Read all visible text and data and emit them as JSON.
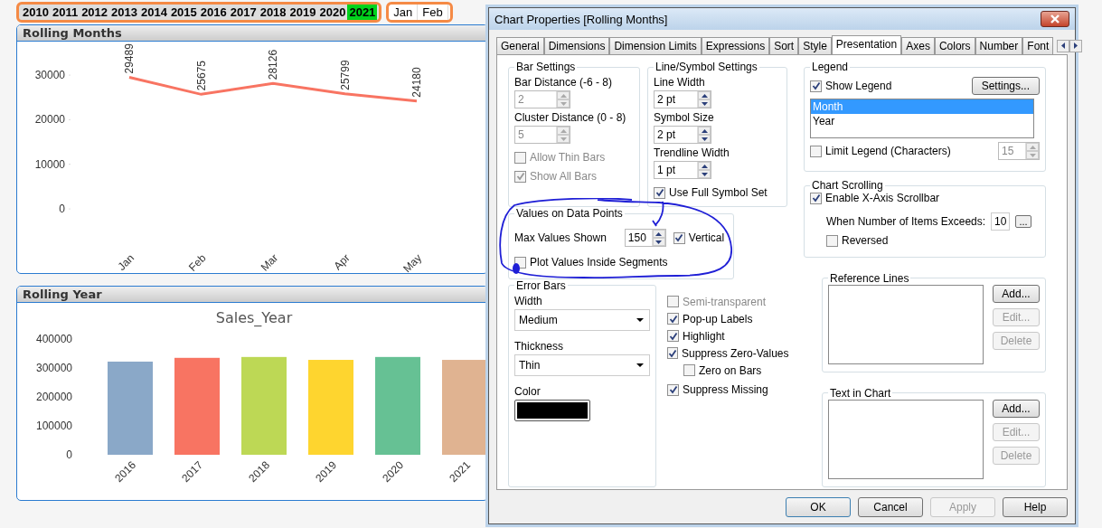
{
  "year_filter": [
    {
      "label": "2010",
      "selected": false
    },
    {
      "label": "2011",
      "selected": false
    },
    {
      "label": "2012",
      "selected": false
    },
    {
      "label": "2013",
      "selected": false
    },
    {
      "label": "2014",
      "selected": false
    },
    {
      "label": "2015",
      "selected": false
    },
    {
      "label": "2016",
      "selected": false
    },
    {
      "label": "2017",
      "selected": false
    },
    {
      "label": "2018",
      "selected": false
    },
    {
      "label": "2019",
      "selected": false
    },
    {
      "label": "2020",
      "selected": false
    },
    {
      "label": "2021",
      "selected": true
    }
  ],
  "month_filter": [
    {
      "label": "Jan",
      "selected": false
    },
    {
      "label": "Feb",
      "selected": false
    }
  ],
  "rolling_months": {
    "title": "Rolling Months",
    "chart_data": {
      "type": "line",
      "categories": [
        "Jan",
        "Feb",
        "Mar",
        "Apr",
        "May"
      ],
      "series": [
        {
          "color": "#f87462",
          "values": [
            29489,
            25675,
            28126,
            25799,
            24180
          ]
        }
      ],
      "yticks": [
        0,
        10000,
        20000,
        30000
      ],
      "ylim": [
        0,
        30000
      ],
      "data_labels": true
    }
  },
  "rolling_year": {
    "title": "Rolling Year",
    "chart_data": {
      "type": "bar",
      "title": "Sales_Year",
      "categories": [
        "2016",
        "2017",
        "2018",
        "2019",
        "2020",
        "2021"
      ],
      "values": [
        322000,
        335000,
        338000,
        328000,
        338000,
        328000
      ],
      "colors": [
        "#8aa8c8",
        "#f87462",
        "#bdd855",
        "#fed52f",
        "#66c194",
        "#e0b391"
      ],
      "yticks": [
        0,
        100000,
        200000,
        300000,
        400000
      ],
      "ylim": [
        0,
        400000
      ]
    }
  },
  "dialog": {
    "title": "Chart Properties [Rolling Months]",
    "tabs": [
      {
        "label": "General",
        "selected": false
      },
      {
        "label": "Dimensions",
        "selected": false
      },
      {
        "label": "Dimension Limits",
        "selected": false
      },
      {
        "label": "Expressions",
        "selected": false
      },
      {
        "label": "Sort",
        "selected": false
      },
      {
        "label": "Style",
        "selected": false
      },
      {
        "label": "Presentation",
        "selected": true
      },
      {
        "label": "Axes",
        "selected": false
      },
      {
        "label": "Colors",
        "selected": false
      },
      {
        "label": "Number",
        "selected": false
      },
      {
        "label": "Font",
        "selected": false
      }
    ],
    "bar_settings": {
      "title": "Bar Settings",
      "fields": [
        {
          "label": "Bar Distance (-6 - 8)",
          "value": "2",
          "disabled": true
        },
        {
          "label": "Cluster Distance (0 - 8)",
          "value": "5",
          "disabled": true
        }
      ],
      "checkboxes": [
        {
          "label": "Allow Thin Bars",
          "checked": false,
          "disabled": true
        },
        {
          "label": "Show All Bars",
          "checked": true,
          "disabled": true
        }
      ]
    },
    "line_symbol_settings": {
      "title": "Line/Symbol Settings",
      "fields": [
        {
          "label": "Line Width",
          "value": "2 pt",
          "disabled": false
        },
        {
          "label": "Symbol Size",
          "value": "2 pt",
          "disabled": false
        },
        {
          "label": "Trendline Width",
          "value": "1 pt",
          "disabled": false
        }
      ],
      "checkboxes": [
        {
          "label": "Use Full Symbol Set",
          "checked": true,
          "disabled": false
        }
      ]
    },
    "values_on_data_points": {
      "title": "Values on Data Points",
      "max_values_label": "Max Values Shown",
      "max_values": "150",
      "vertical": {
        "label": "Vertical",
        "checked": true
      },
      "plot_inside": {
        "label": "Plot Values Inside Segments",
        "checked": false
      }
    },
    "error_bars": {
      "title": "Error Bars",
      "width_label": "Width",
      "width_value": "Medium",
      "thickness_label": "Thickness",
      "thickness_value": "Thin",
      "color_label": "Color",
      "color": "#000000"
    },
    "options": [
      {
        "label": "Semi-transparent",
        "checked": false,
        "disabled": true
      },
      {
        "label": "Pop-up Labels",
        "checked": true,
        "disabled": false
      },
      {
        "label": "Highlight",
        "checked": true,
        "disabled": false
      },
      {
        "label": "Suppress Zero-Values",
        "checked": true,
        "disabled": false,
        "children": [
          {
            "label": "Zero on Bars",
            "checked": false,
            "disabled": false
          }
        ]
      },
      {
        "label": "Suppress Missing",
        "checked": true,
        "disabled": false
      }
    ],
    "legend": {
      "title": "Legend",
      "show_legend": {
        "label": "Show Legend",
        "checked": true
      },
      "settings_button": "Settings...",
      "items": [
        {
          "label": "Month",
          "selected": true
        },
        {
          "label": "Year",
          "selected": false
        }
      ],
      "limit_legend": {
        "label": "Limit Legend (Characters)",
        "checked": false
      },
      "limit_value": "15"
    },
    "chart_scrolling": {
      "title": "Chart Scrolling",
      "enable": {
        "label": "Enable X-Axis Scrollbar",
        "checked": true
      },
      "items_label": "When Number of Items Exceeds:",
      "items_value": "10",
      "browse_button": "...",
      "reversed": {
        "label": "Reversed",
        "checked": false
      }
    },
    "reference_lines": {
      "title": "Reference Lines",
      "buttons": [
        {
          "label": "Add...",
          "disabled": false
        },
        {
          "label": "Edit...",
          "disabled": true
        },
        {
          "label": "Delete",
          "disabled": true
        }
      ]
    },
    "text_in_chart": {
      "title": "Text in Chart",
      "buttons": [
        {
          "label": "Add...",
          "disabled": false
        },
        {
          "label": "Edit...",
          "disabled": true
        },
        {
          "label": "Delete",
          "disabled": true
        }
      ]
    },
    "buttons": [
      {
        "label": "OK",
        "disabled": false
      },
      {
        "label": "Cancel",
        "disabled": false
      },
      {
        "label": "Apply",
        "disabled": true
      },
      {
        "label": "Help",
        "disabled": false
      }
    ]
  }
}
